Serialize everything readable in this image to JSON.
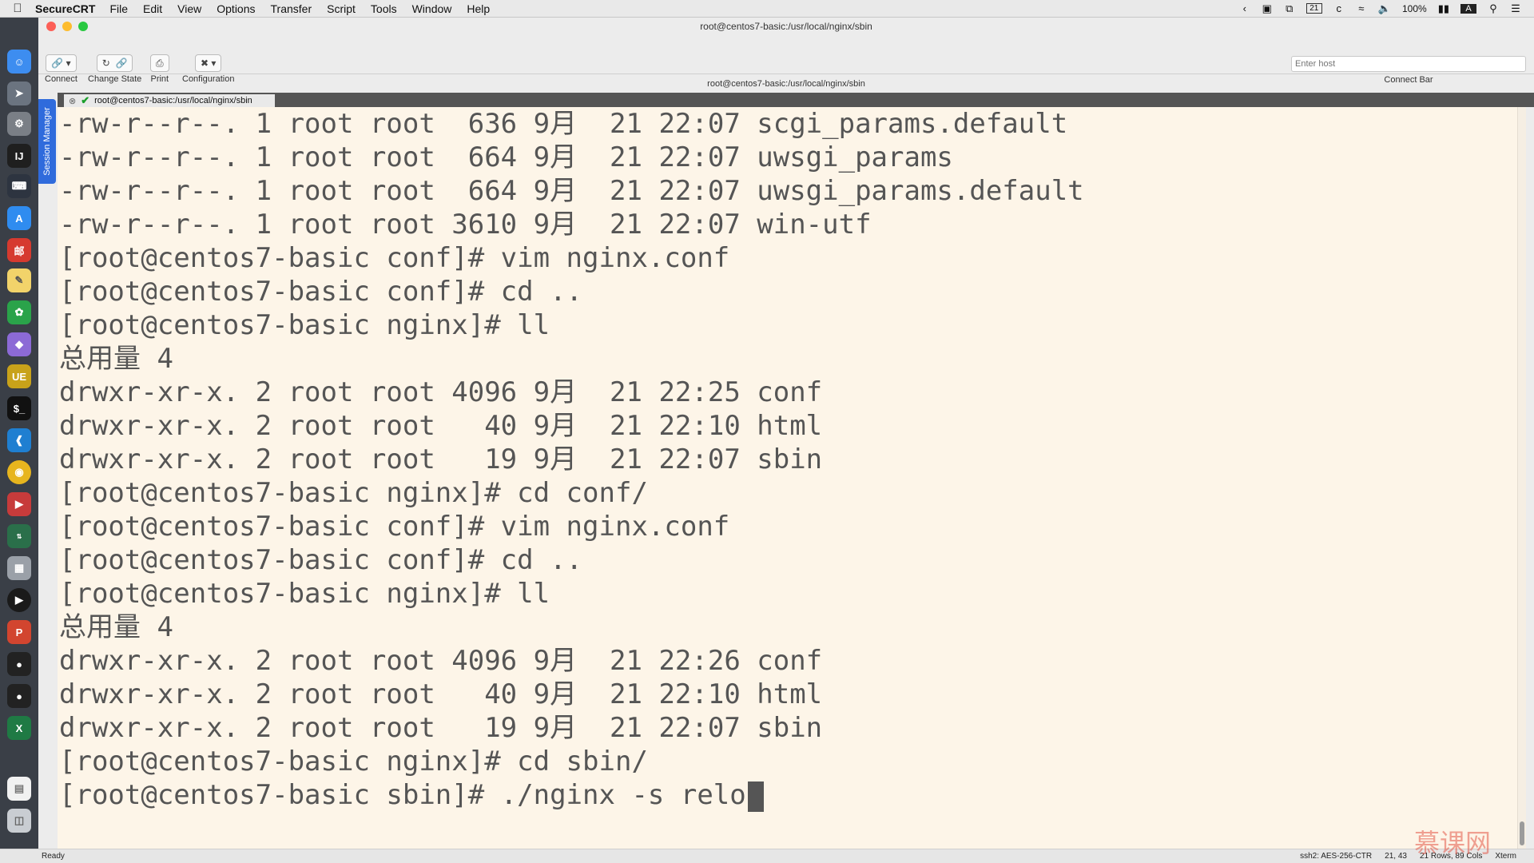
{
  "menubar": {
    "app_name": "SecureCRT",
    "menus": [
      "File",
      "Edit",
      "View",
      "Options",
      "Transfer",
      "Script",
      "Tools",
      "Window",
      "Help"
    ],
    "battery": "100%",
    "calendar_day": "21",
    "input_source": "A"
  },
  "window": {
    "title": "root@centos7-basic:/usr/local/nginx/sbin",
    "session_title": "root@centos7-basic:/usr/local/nginx/sbin",
    "tab_label": "root@centos7-basic:/usr/local/nginx/sbin"
  },
  "toolbar": {
    "connect": "Connect",
    "change_state": "Change State",
    "print": "Print",
    "configuration": "Configuration",
    "host_placeholder": "Enter host",
    "connect_bar": "Connect Bar"
  },
  "session_manager": {
    "label": "Session Manager"
  },
  "terminal": {
    "lines": [
      "-rw-r--r--. 1 root root  636 9月  21 22:07 scgi_params.default",
      "-rw-r--r--. 1 root root  664 9月  21 22:07 uwsgi_params",
      "-rw-r--r--. 1 root root  664 9月  21 22:07 uwsgi_params.default",
      "-rw-r--r--. 1 root root 3610 9月  21 22:07 win-utf",
      "[root@centos7-basic conf]# vim nginx.conf",
      "[root@centos7-basic conf]# cd ..",
      "[root@centos7-basic nginx]# ll",
      "总用量 4",
      "drwxr-xr-x. 2 root root 4096 9月  21 22:25 conf",
      "drwxr-xr-x. 2 root root   40 9月  21 22:10 html",
      "drwxr-xr-x. 2 root root   19 9月  21 22:07 sbin",
      "[root@centos7-basic nginx]# cd conf/",
      "[root@centos7-basic conf]# vim nginx.conf",
      "[root@centos7-basic conf]# cd ..",
      "[root@centos7-basic nginx]# ll",
      "总用量 4",
      "drwxr-xr-x. 2 root root 4096 9月  21 22:26 conf",
      "drwxr-xr-x. 2 root root   40 9月  21 22:10 html",
      "drwxr-xr-x. 2 root root   19 9月  21 22:07 sbin",
      "[root@centos7-basic nginx]# cd sbin/"
    ],
    "current_line": "[root@centos7-basic sbin]# ./nginx -s relo"
  },
  "statusbar": {
    "ready": "Ready",
    "cipher": "ssh2: AES-256-CTR",
    "cursor_pos": "21, 43",
    "size": "21 Rows, 89 Cols",
    "term_type": "Xterm"
  },
  "watermark": "慕课网",
  "colors": {
    "terminal_bg": "#fdf5e8",
    "terminal_fg": "#555555",
    "session_tab": "#2f6bdc"
  }
}
